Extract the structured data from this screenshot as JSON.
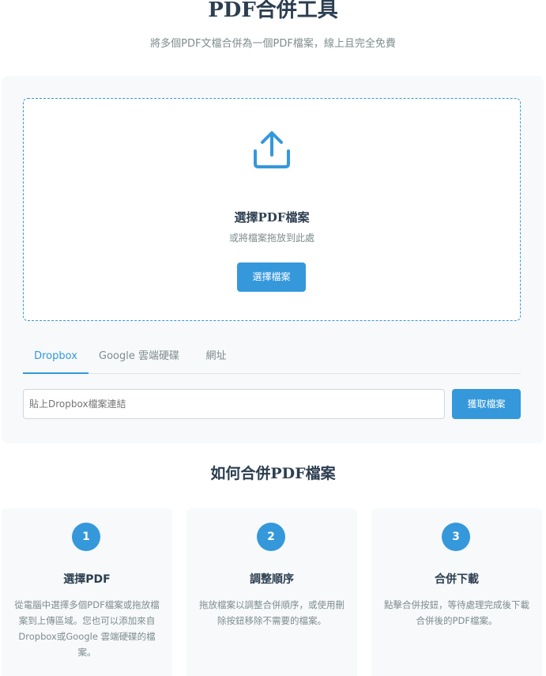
{
  "header": {
    "title": "PDF合併工具",
    "subtitle": "將多個PDF文檔合併為一個PDF檔案，線上且完全免費"
  },
  "upload": {
    "icon": "upload-icon",
    "title": "選擇PDF檔案",
    "hint": "或將檔案拖放到此處",
    "choose_button": "選擇檔案"
  },
  "tabs": [
    {
      "label": "Dropbox",
      "active": true
    },
    {
      "label": "Google 雲端硬碟",
      "active": false
    },
    {
      "label": "網址",
      "active": false
    }
  ],
  "link": {
    "placeholder": "貼上Dropbox檔案連結",
    "fetch_button": "獲取檔案"
  },
  "howto": {
    "title": "如何合併PDF檔案",
    "steps": [
      {
        "number": "1",
        "title": "選擇PDF",
        "description": "從電腦中選擇多個PDF檔案或拖放檔案到上傳區域。您也可以添加來自Dropbox或Google 雲端硬碟的檔案。"
      },
      {
        "number": "2",
        "title": "調整順序",
        "description": "拖放檔案以調整合併順序，或使用刪除按鈕移除不需要的檔案。"
      },
      {
        "number": "3",
        "title": "合併下載",
        "description": "點擊合併按鈕，等待處理完成後下載合併後的PDF檔案。"
      }
    ]
  },
  "colors": {
    "accent": "#3498db",
    "text": "#2c3e50",
    "muted": "#7f8c8d",
    "panel": "#f7f9fb"
  }
}
